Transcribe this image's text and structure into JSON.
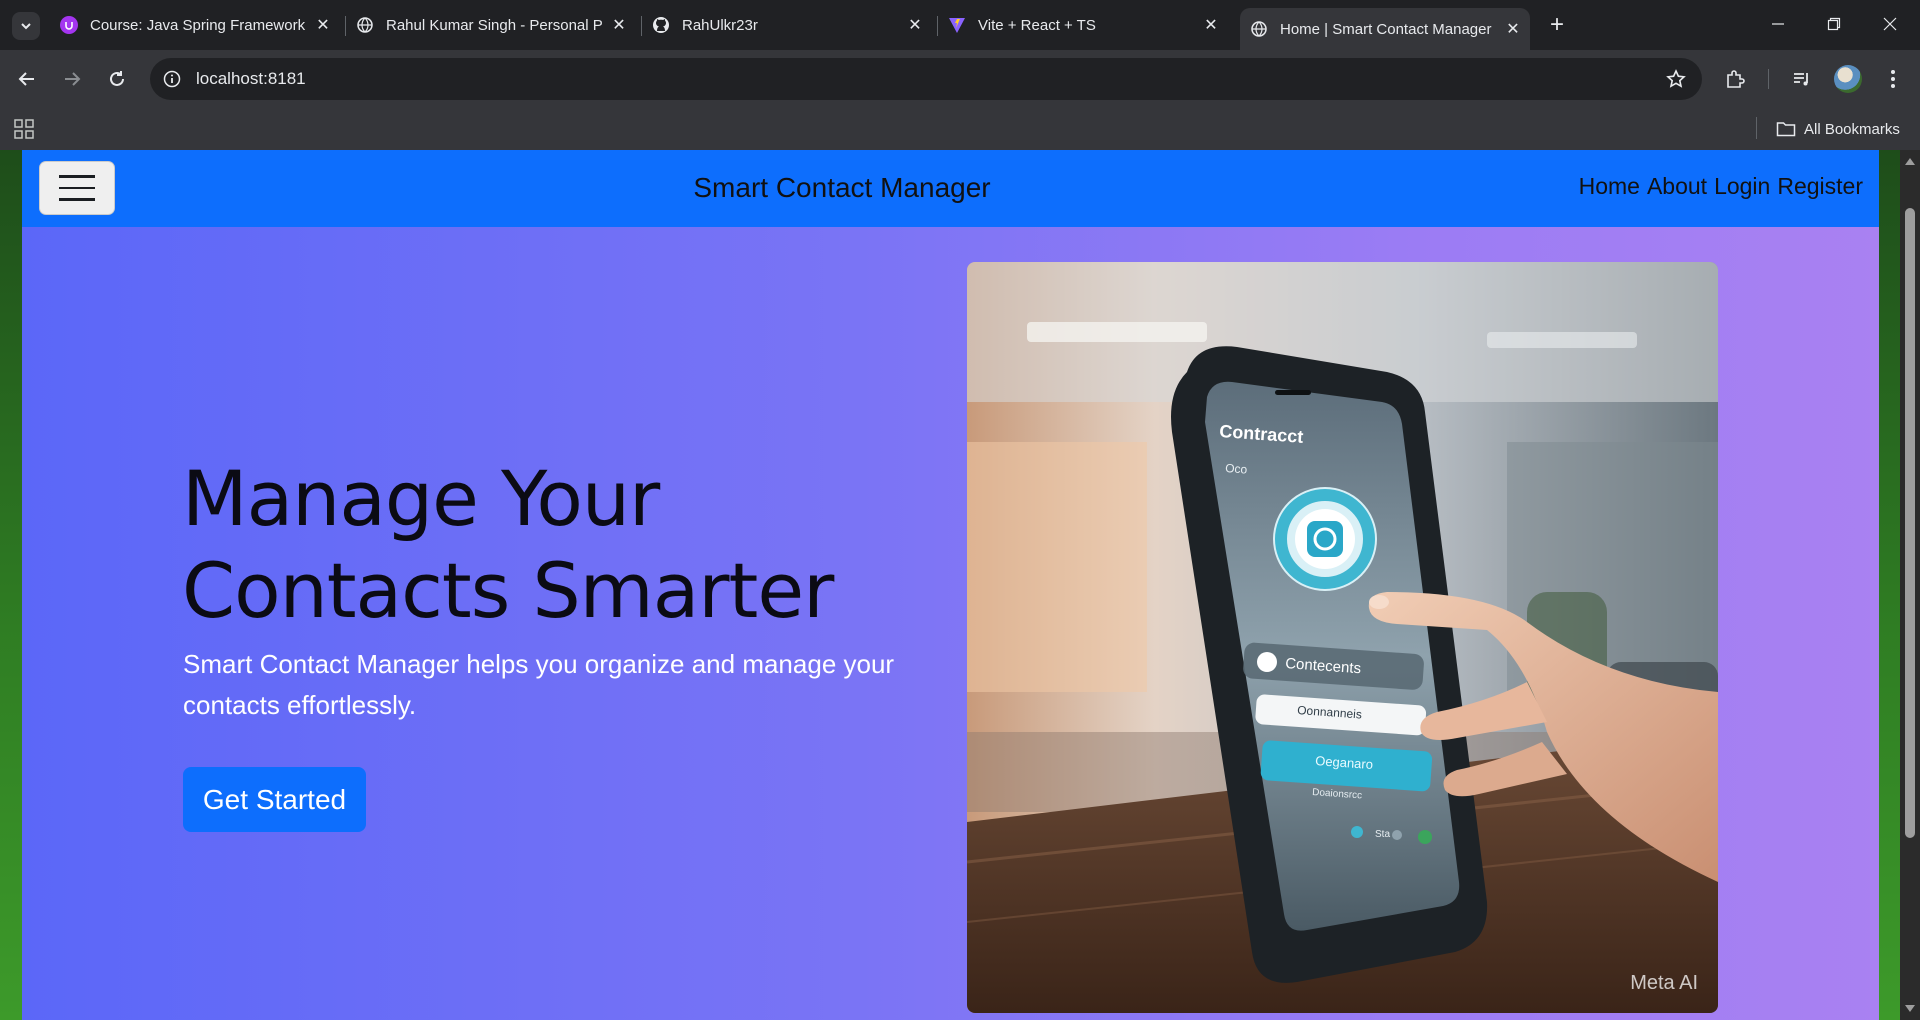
{
  "browser": {
    "tabs": [
      {
        "title": "Course: Java Spring Framework",
        "favicon": "udemy-icon",
        "color": "#a435f0"
      },
      {
        "title": "Rahul Kumar Singh - Personal P",
        "favicon": "globe-icon"
      },
      {
        "title": "RahUlkr23r",
        "favicon": "github-icon"
      },
      {
        "title": "Vite + React + TS",
        "favicon": "vite-icon"
      },
      {
        "title": "Home | Smart Contact Manager",
        "favicon": "globe-icon",
        "active": true
      }
    ],
    "address": "localhost:8181",
    "bookmarks": {
      "all_label": "All Bookmarks"
    }
  },
  "navbar": {
    "brand": "Smart Contact Manager",
    "links": [
      "Home",
      "About",
      "Login",
      "Register"
    ],
    "color": "#0d6efd"
  },
  "hero": {
    "headline": "Manage Your Contacts Smarter",
    "subtext": "Smart Contact Manager helps you organize and manage your contacts effortlessly.",
    "cta_label": "Get Started",
    "image": {
      "description_icon": "phone-contacts-illustration",
      "watermark": "Meta AI",
      "phone_screen": {
        "title": "Contracct",
        "label_top": "Oco",
        "item_label": "Contecents",
        "field_text": "Oonnanneis",
        "button_text": "Oeganaro",
        "caption": "Doaionsrcc",
        "bottom_text": "Sta"
      }
    }
  }
}
